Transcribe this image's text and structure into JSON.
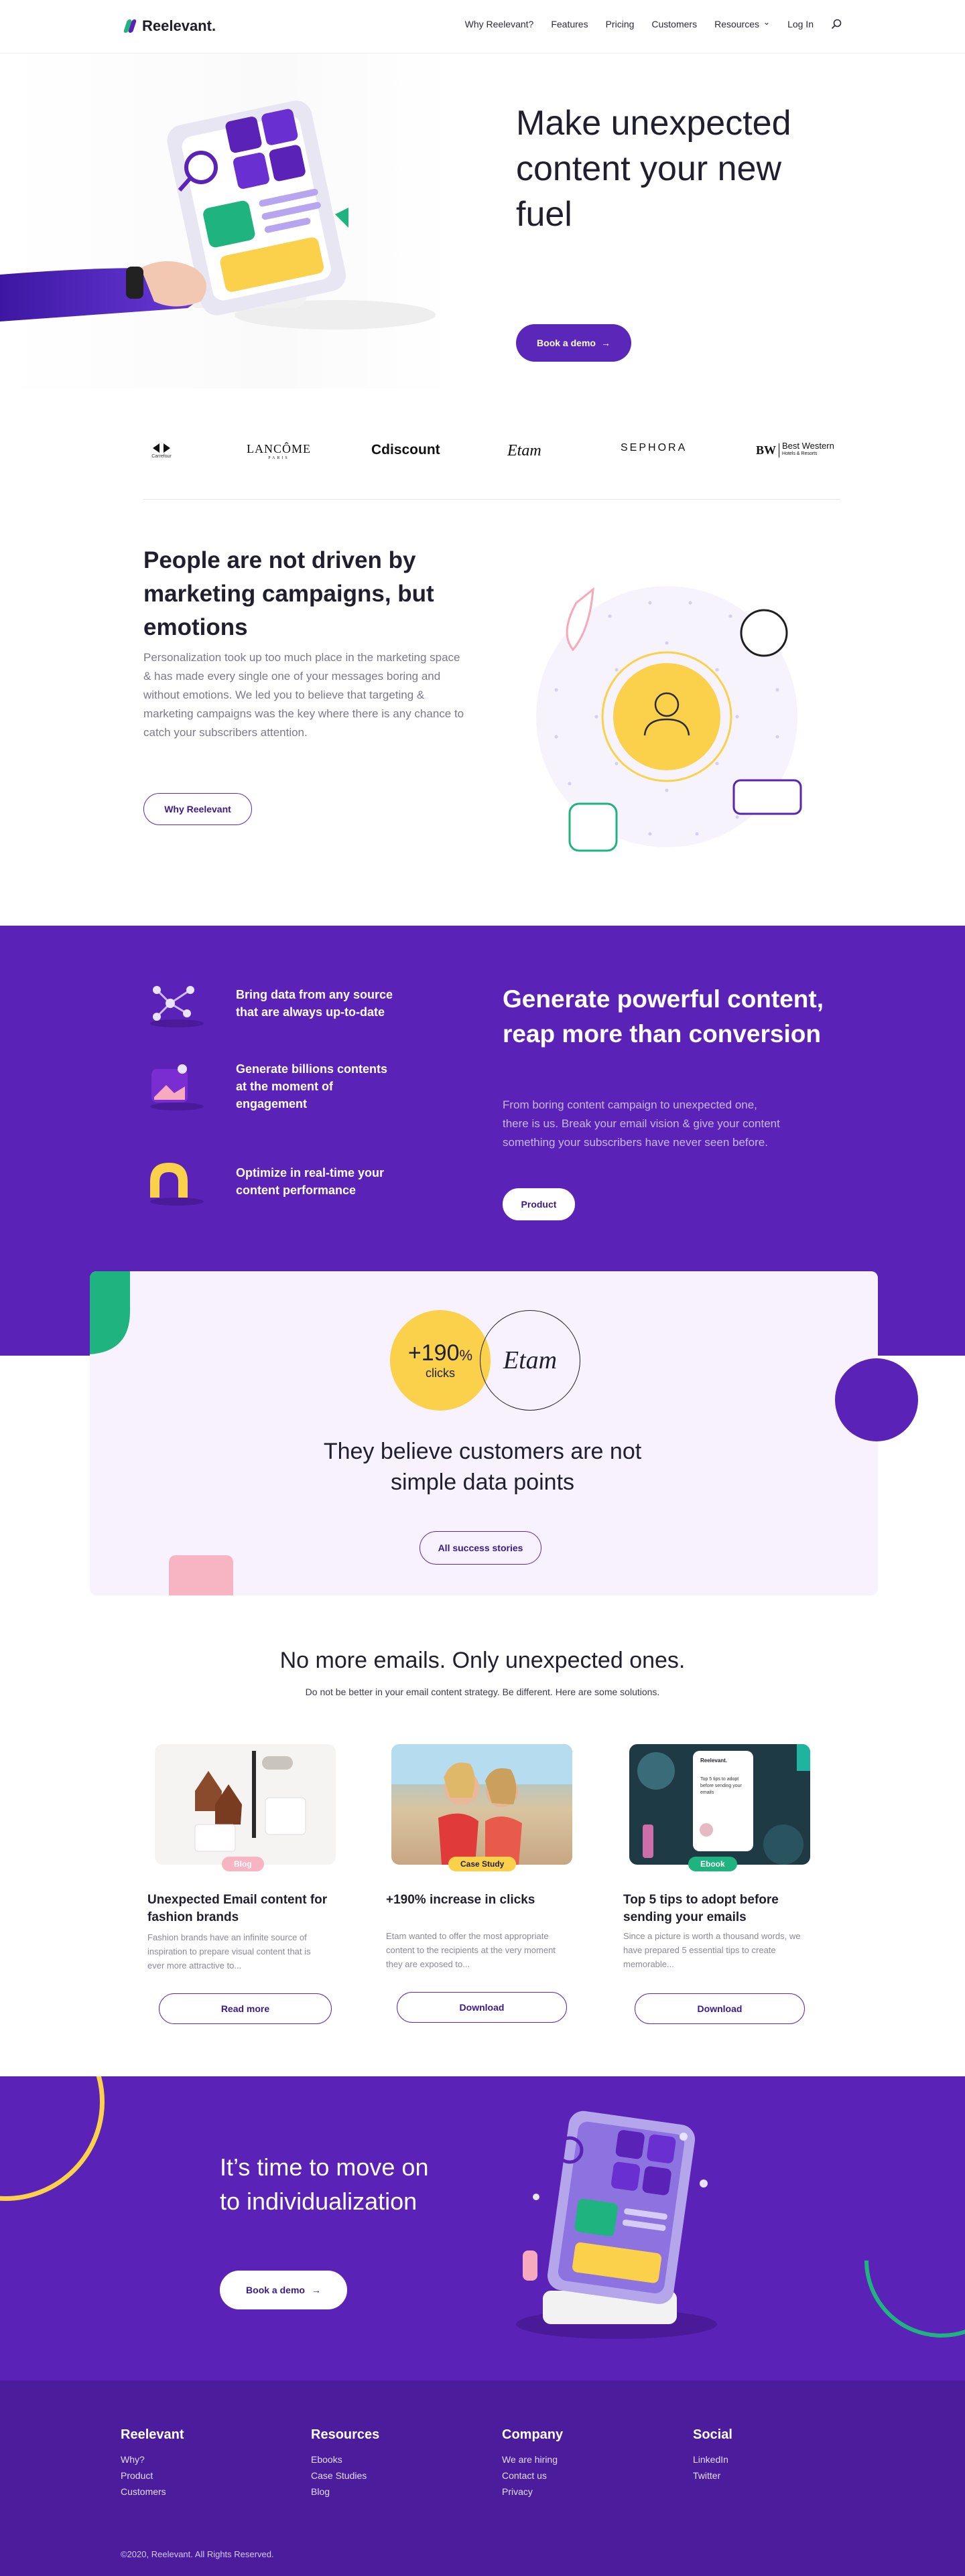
{
  "header": {
    "logo_text": "Reelevant.",
    "nav": [
      "Why Reelevant?",
      "Features",
      "Pricing",
      "Customers",
      "Resources",
      "Log In"
    ],
    "resources_caret": "⌄"
  },
  "hero": {
    "title": "Make unexpected content your new fuel",
    "cta": "Book a demo",
    "cta_arrow": "→"
  },
  "brands": [
    "Carrefour",
    "LANCÔME",
    "Cdiscount",
    "Etam",
    "SEPHORA",
    "Best Western"
  ],
  "brand_sub": {
    "carrefour": "Carrefour",
    "lancome": "PARIS",
    "bw_mark": "BW",
    "bestwestern": "Hotels & Resorts"
  },
  "emotions": {
    "title": "People are not driven by marketing campaigns, but emotions",
    "body": "Personalization took up too much place in the marketing space & has made every single one of your messages boring and without emotions. We led you to believe that targeting & marketing campaigns was the key where there is any chance to catch your subscribers attention.",
    "cta": "Why Reelevant"
  },
  "features": {
    "items": [
      "Bring data from any source that are always up-to-date",
      "Generate billions contents at the moment of engagement",
      "Optimize in real-time your content performance"
    ],
    "title": "Generate powerful content, reap more than conversion",
    "body": "From boring content campaign to unexpected one, there is us. Break your email vision & give your content something your subscribers have never seen before.",
    "cta": "Product"
  },
  "success": {
    "stat_value": "+190",
    "stat_unit": "%",
    "stat_label": "clicks",
    "brand": "Etam",
    "title": "They believe customers are not simple data points",
    "cta": "All success stories"
  },
  "resources": {
    "title": "No more emails. Only unexpected ones.",
    "subtitle": "Do not be better in your email content strategy. Be different. Here are some solutions.",
    "cards": [
      {
        "tag": "Blog",
        "title": "Unexpected Email content for fashion brands",
        "desc": "Fashion brands have an infinite source of inspiration to prepare visual content that is ever more attractive to...",
        "cta": "Read more"
      },
      {
        "tag": "Case Study",
        "title": "+190% increase in clicks",
        "desc": "Etam wanted to offer the most appropriate content to the recipients at the very moment they are exposed to...",
        "cta": "Download"
      },
      {
        "tag": "Ebook",
        "title": "Top 5 tips to adopt before sending your emails",
        "desc": "Since a picture is worth a thousand words, we have prepared 5 essential tips to create memorable...",
        "cta": "Download"
      }
    ],
    "ebook_brand": "Reelevant.",
    "ebook_title": "Top 5 tips to adopt before sending your emails"
  },
  "cta_section": {
    "title": "It’s time to move on to individualization",
    "cta": "Book a demo",
    "cta_arrow": "→"
  },
  "footer": {
    "columns": [
      {
        "title": "Reelevant",
        "links": [
          "Why?",
          "Product",
          "Customers"
        ]
      },
      {
        "title": "Resources",
        "links": [
          "Ebooks",
          "Case Studies",
          "Blog"
        ]
      },
      {
        "title": "Company",
        "links": [
          "We are hiring",
          "Contact us",
          "Privacy"
        ]
      },
      {
        "title": "Social",
        "links": [
          "LinkedIn",
          "Twitter"
        ]
      }
    ],
    "copyright": "©2020, Reelevant. All Rights Reserved."
  },
  "colors": {
    "brand_purple": "#5a22b6",
    "accent_yellow": "#fbd14b",
    "accent_green": "#1fb47f",
    "accent_pink": "#f7b5c4",
    "footer_purple": "#4b1c9c"
  }
}
